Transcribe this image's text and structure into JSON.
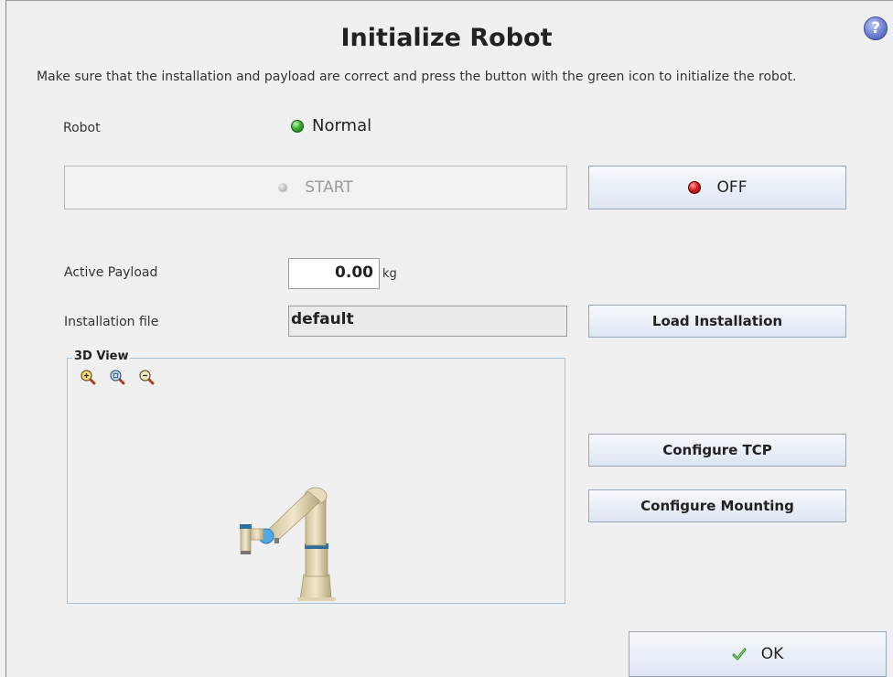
{
  "dialog": {
    "title": "Initialize Robot",
    "help_icon": "?",
    "instruction": "Make sure that the installation and payload are correct and press the button with the green icon to initialize the robot."
  },
  "robot": {
    "label": "Robot",
    "status": "Normal",
    "status_color": "#3cae35"
  },
  "power": {
    "start_label": "START",
    "off_label": "OFF"
  },
  "payload": {
    "label": "Active Payload",
    "value": "0.00",
    "unit": "kg"
  },
  "installation": {
    "label": "Installation file",
    "value": "default",
    "load_label": "Load Installation"
  },
  "view3d": {
    "title": "3D View",
    "icons": [
      "zoom-in-icon",
      "zoom-reset-icon",
      "zoom-out-icon"
    ]
  },
  "actions": {
    "configure_tcp": "Configure TCP",
    "configure_mounting": "Configure Mounting",
    "ok": "OK"
  }
}
